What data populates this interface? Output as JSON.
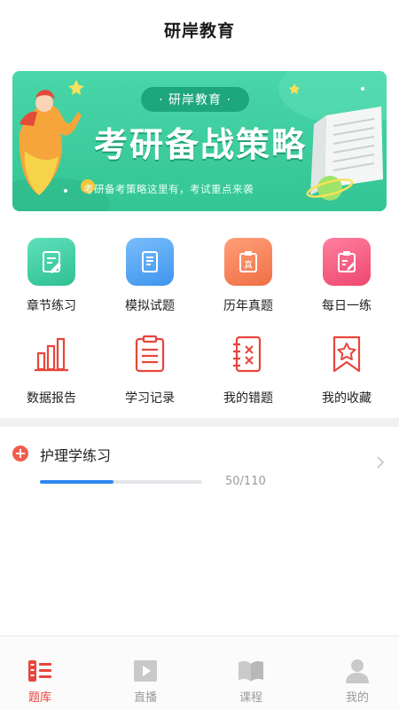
{
  "header": {
    "title": "研岸教育"
  },
  "banner": {
    "brand": "· 研岸教育 ·",
    "headline": "考研备战策略",
    "subtitle": "考研备考策略这里有，考试重点来袭"
  },
  "features": [
    {
      "label": "章节练习",
      "icon": "chapter-practice-icon",
      "color": "#34c79c"
    },
    {
      "label": "模拟试题",
      "icon": "mock-exam-icon",
      "color": "#4aa4f3"
    },
    {
      "label": "历年真题",
      "icon": "past-exam-icon",
      "color": "#f48157"
    },
    {
      "label": "每日一练",
      "icon": "daily-practice-icon",
      "color": "#f2587c"
    },
    {
      "label": "数据报告",
      "icon": "data-report-icon",
      "color": "#e8453c"
    },
    {
      "label": "学习记录",
      "icon": "study-record-icon",
      "color": "#e8453c"
    },
    {
      "label": "我的错题",
      "icon": "wrong-questions-icon",
      "color": "#e8453c"
    },
    {
      "label": "我的收藏",
      "icon": "favorites-icon",
      "color": "#e8453c"
    }
  ],
  "practice": {
    "name": "护理学练习",
    "done": 50,
    "total": 110,
    "count_text": "50/110"
  },
  "tabs": [
    {
      "label": "题库",
      "icon": "question-bank-icon",
      "active": true
    },
    {
      "label": "直播",
      "icon": "live-icon",
      "active": false
    },
    {
      "label": "课程",
      "icon": "course-icon",
      "active": false
    },
    {
      "label": "我的",
      "icon": "profile-icon",
      "active": false
    }
  ],
  "colors": {
    "accent": "#e8453c",
    "progress": "#2f86f0",
    "banner": "#3fcd9e"
  }
}
